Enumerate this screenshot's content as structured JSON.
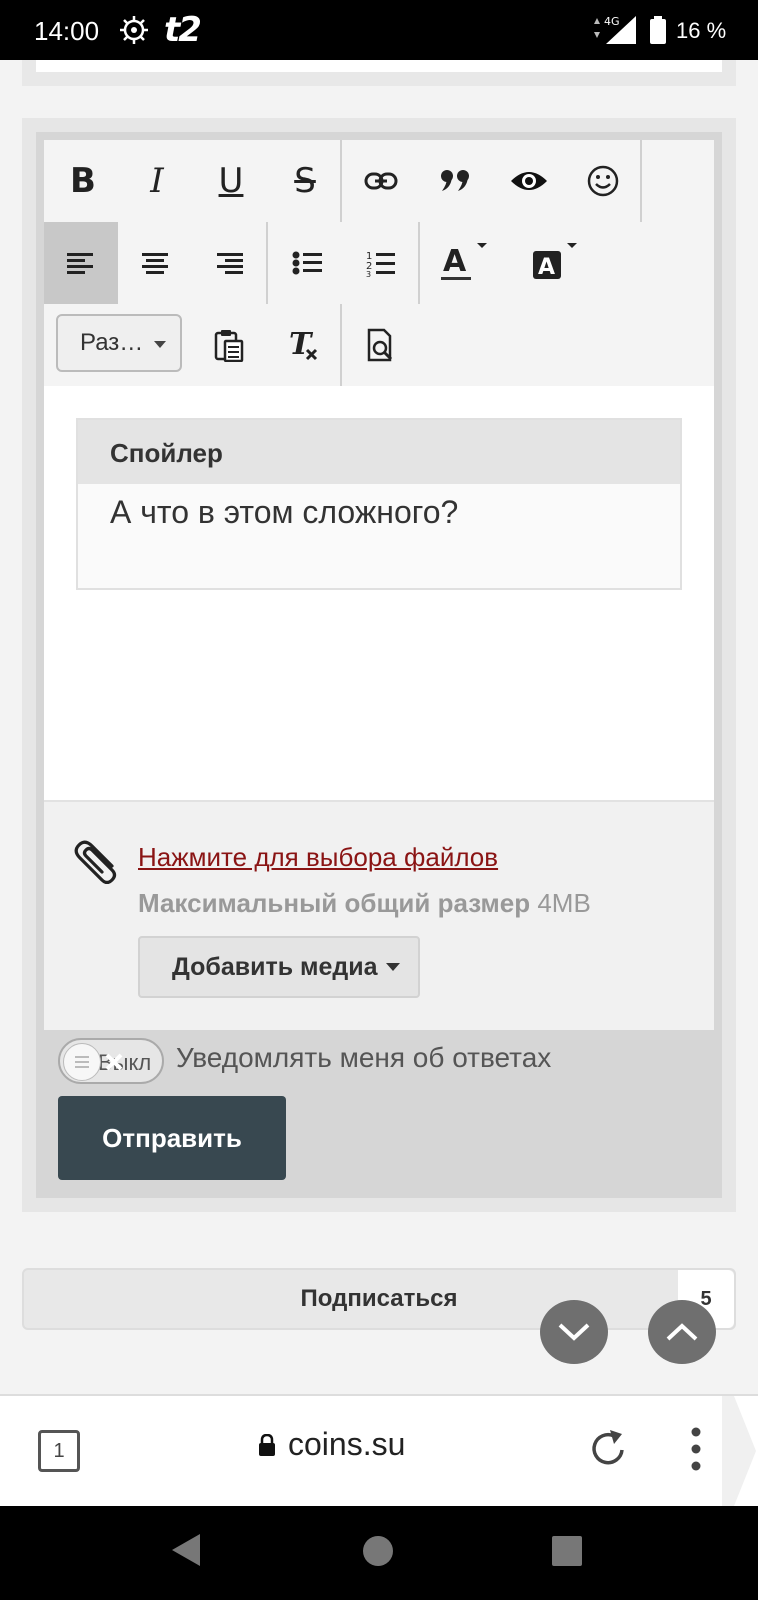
{
  "status_bar": {
    "time": "14:00",
    "carrier": "t2",
    "network": "4G",
    "battery": "16 %"
  },
  "toolbar": {
    "row1": [
      {
        "name": "bold",
        "glyph": "B"
      },
      {
        "name": "italic",
        "glyph": "I"
      },
      {
        "name": "underline",
        "glyph": "U"
      },
      {
        "name": "strikethrough",
        "glyph": "S"
      },
      {
        "name": "link-icon"
      },
      {
        "name": "quote",
        "glyph": "”"
      },
      {
        "name": "eye-icon"
      },
      {
        "name": "smile-icon"
      }
    ],
    "size_select": "Раз…"
  },
  "editor": {
    "spoiler_title": "Спойлер",
    "spoiler_text": "А что в этом сложного?"
  },
  "attachments": {
    "link": "Нажмите для выбора файлов",
    "max_label": "Максимальный общий размер",
    "max_value": "4MB",
    "add_media": "Добавить медиа"
  },
  "notify": {
    "toggle_text": "Выкл",
    "label": "Уведомлять меня об ответах"
  },
  "send_button": "Отправить",
  "subscribe": {
    "label": "Подписаться",
    "count": "5"
  },
  "browser": {
    "tab_count": "1",
    "url": "coins.su"
  },
  "colors": {
    "send_button_bg": "#384850",
    "link_color": "#8a1414"
  }
}
